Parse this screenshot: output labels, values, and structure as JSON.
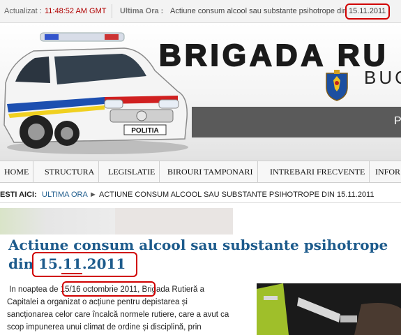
{
  "topbar": {
    "updated_label": "Actualizat :",
    "time": "11:48:52 AM GMT",
    "breaking_label": "Ultima Ora :",
    "breaking_text": "Actiune consum alcool sau substante psihotrope din",
    "breaking_date": "15.11.2011"
  },
  "header": {
    "brand_title": "BRIGADA RU",
    "brand_subtitle": "BUC",
    "band_letter": "P",
    "car_plate": "POLITIA"
  },
  "nav": {
    "items": [
      "HOME",
      "STRUCTURA",
      "LEGISLATIE",
      "BIROURI TAMPONARI",
      "INTREBARI FRECVENTE",
      "INFOR"
    ]
  },
  "breadcrumb": {
    "label": "ESTI AICI:",
    "link": "ULTIMA ORA",
    "arrow": "►",
    "current": "ACTIUNE CONSUM ALCOOL SAU SUBSTANTE PSIHOTROPE DIN 15.11.2011"
  },
  "article": {
    "title_line1": "Actiune consum alcool sau substante psihotrope",
    "title_line2_prefix": "din ",
    "title_date": "15.11.2011",
    "body_line1_a": "In noaptea de ",
    "body_date": "15/16 octombrie 2011",
    "body_line1_b": ", Brigada Rutieră a",
    "body_line2": "Capitalei a organizat o acțiune pentru depistarea și",
    "body_line3": "sancționarea celor care încalcă normele rutiere, care a avut ca",
    "body_line4": "scop impunerea unui climat de ordine și disciplină, prin"
  },
  "colors": {
    "link_blue": "#1d5b8c",
    "time_red": "#b00000",
    "highlight_red": "#d00000"
  }
}
